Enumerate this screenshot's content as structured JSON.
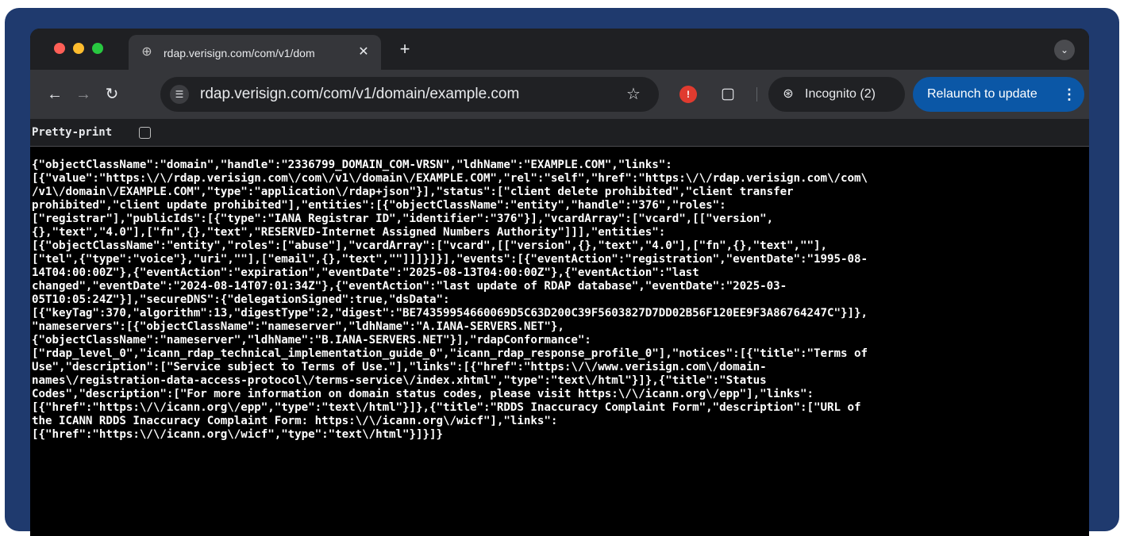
{
  "browser": {
    "tab": {
      "title": "rdap.verisign.com/com/v1/dom",
      "favicon": "globe-icon",
      "close": "✕"
    },
    "new_tab": "+",
    "toolbar": {
      "url": "rdap.verisign.com/com/v1/domain/example.com",
      "incognito_label": "Incognito (2)",
      "relaunch_label": "Relaunch to update"
    }
  },
  "page": {
    "pretty_print_label": "Pretty-print",
    "pretty_print_checked": false,
    "json_lines": [
      "{\"objectClassName\":\"domain\",\"handle\":\"2336799_DOMAIN_COM-VRSN\",\"ldhName\":\"EXAMPLE.COM\",\"links\":",
      "[{\"value\":\"https:\\/\\/rdap.verisign.com\\/com\\/v1\\/domain\\/EXAMPLE.COM\",\"rel\":\"self\",\"href\":\"https:\\/\\/rdap.verisign.com\\/com\\",
      "/v1\\/domain\\/EXAMPLE.COM\",\"type\":\"application\\/rdap+json\"}],\"status\":[\"client delete prohibited\",\"client transfer",
      "prohibited\",\"client update prohibited\"],\"entities\":[{\"objectClassName\":\"entity\",\"handle\":\"376\",\"roles\":",
      "[\"registrar\"],\"publicIds\":[{\"type\":\"IANA Registrar ID\",\"identifier\":\"376\"}],\"vcardArray\":[\"vcard\",[[\"version\",",
      "{},\"text\",\"4.0\"],[\"fn\",{},\"text\",\"RESERVED-Internet Assigned Numbers Authority\"]]],\"entities\":",
      "[{\"objectClassName\":\"entity\",\"roles\":[\"abuse\"],\"vcardArray\":[\"vcard\",[[\"version\",{},\"text\",\"4.0\"],[\"fn\",{},\"text\",\"\"],",
      "[\"tel\",{\"type\":\"voice\"},\"uri\",\"\"],[\"email\",{},\"text\",\"\"]]]}]}],\"events\":[{\"eventAction\":\"registration\",\"eventDate\":\"1995-08-",
      "14T04:00:00Z\"},{\"eventAction\":\"expiration\",\"eventDate\":\"2025-08-13T04:00:00Z\"},{\"eventAction\":\"last",
      "changed\",\"eventDate\":\"2024-08-14T07:01:34Z\"},{\"eventAction\":\"last update of RDAP database\",\"eventDate\":\"2025-03-",
      "05T10:05:24Z\"}],\"secureDNS\":{\"delegationSigned\":true,\"dsData\":",
      "[{\"keyTag\":370,\"algorithm\":13,\"digestType\":2,\"digest\":\"BE74359954660069D5C63D200C39F5603827D7DD02B56F120EE9F3A86764247C\"}]},",
      "\"nameservers\":[{\"objectClassName\":\"nameserver\",\"ldhName\":\"A.IANA-SERVERS.NET\"},",
      "{\"objectClassName\":\"nameserver\",\"ldhName\":\"B.IANA-SERVERS.NET\"}],\"rdapConformance\":",
      "[\"rdap_level_0\",\"icann_rdap_technical_implementation_guide_0\",\"icann_rdap_response_profile_0\"],\"notices\":[{\"title\":\"Terms of",
      "Use\",\"description\":[\"Service subject to Terms of Use.\"],\"links\":[{\"href\":\"https:\\/\\/www.verisign.com\\/domain-",
      "names\\/registration-data-access-protocol\\/terms-service\\/index.xhtml\",\"type\":\"text\\/html\"}]},{\"title\":\"Status",
      "Codes\",\"description\":[\"For more information on domain status codes, please visit https:\\/\\/icann.org\\/epp\"],\"links\":",
      "[{\"href\":\"https:\\/\\/icann.org\\/epp\",\"type\":\"text\\/html\"}]},{\"title\":\"RDDS Inaccuracy Complaint Form\",\"description\":[\"URL of",
      "the ICANN RDDS Inaccuracy Complaint Form: https:\\/\\/icann.org\\/wicf\"],\"links\":",
      "[{\"href\":\"https:\\/\\/icann.org\\/wicf\",\"type\":\"text\\/html\"}]}]}"
    ]
  }
}
